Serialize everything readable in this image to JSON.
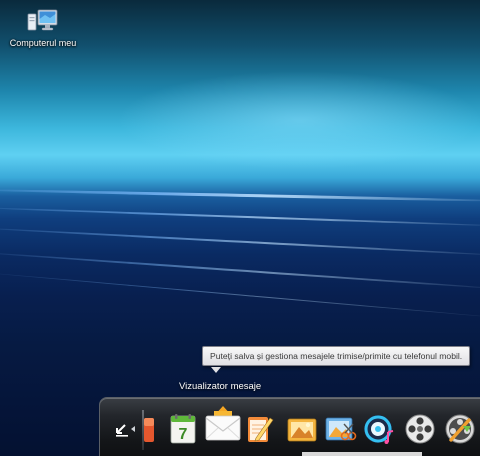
{
  "desktop": {
    "icons": [
      {
        "label": "Computerul meu",
        "icon": "computer-icon"
      }
    ]
  },
  "tooltip": {
    "text": "Puteți salva și gestiona mesajele trimise/primite cu telefonul mobil."
  },
  "hovered_app": {
    "title": "Vizualizator mesaje"
  },
  "dock": {
    "items": [
      {
        "icon": "collapse-arrow-icon"
      },
      {
        "icon": "orange-app-icon"
      },
      {
        "icon": "calendar-icon",
        "value": "7"
      },
      {
        "icon": "messages-envelope-icon"
      },
      {
        "icon": "notes-pencil-icon"
      },
      {
        "icon": "photo-viewer-icon"
      },
      {
        "icon": "photo-editor-icon"
      },
      {
        "icon": "music-player-icon"
      },
      {
        "icon": "video-reel-icon"
      },
      {
        "icon": "video-editor-icon"
      }
    ]
  },
  "colors": {
    "tooltip_bg": "#f1f1f3",
    "dock_bg": "#1a1c20",
    "accent_blue": "#5fd0f2"
  }
}
